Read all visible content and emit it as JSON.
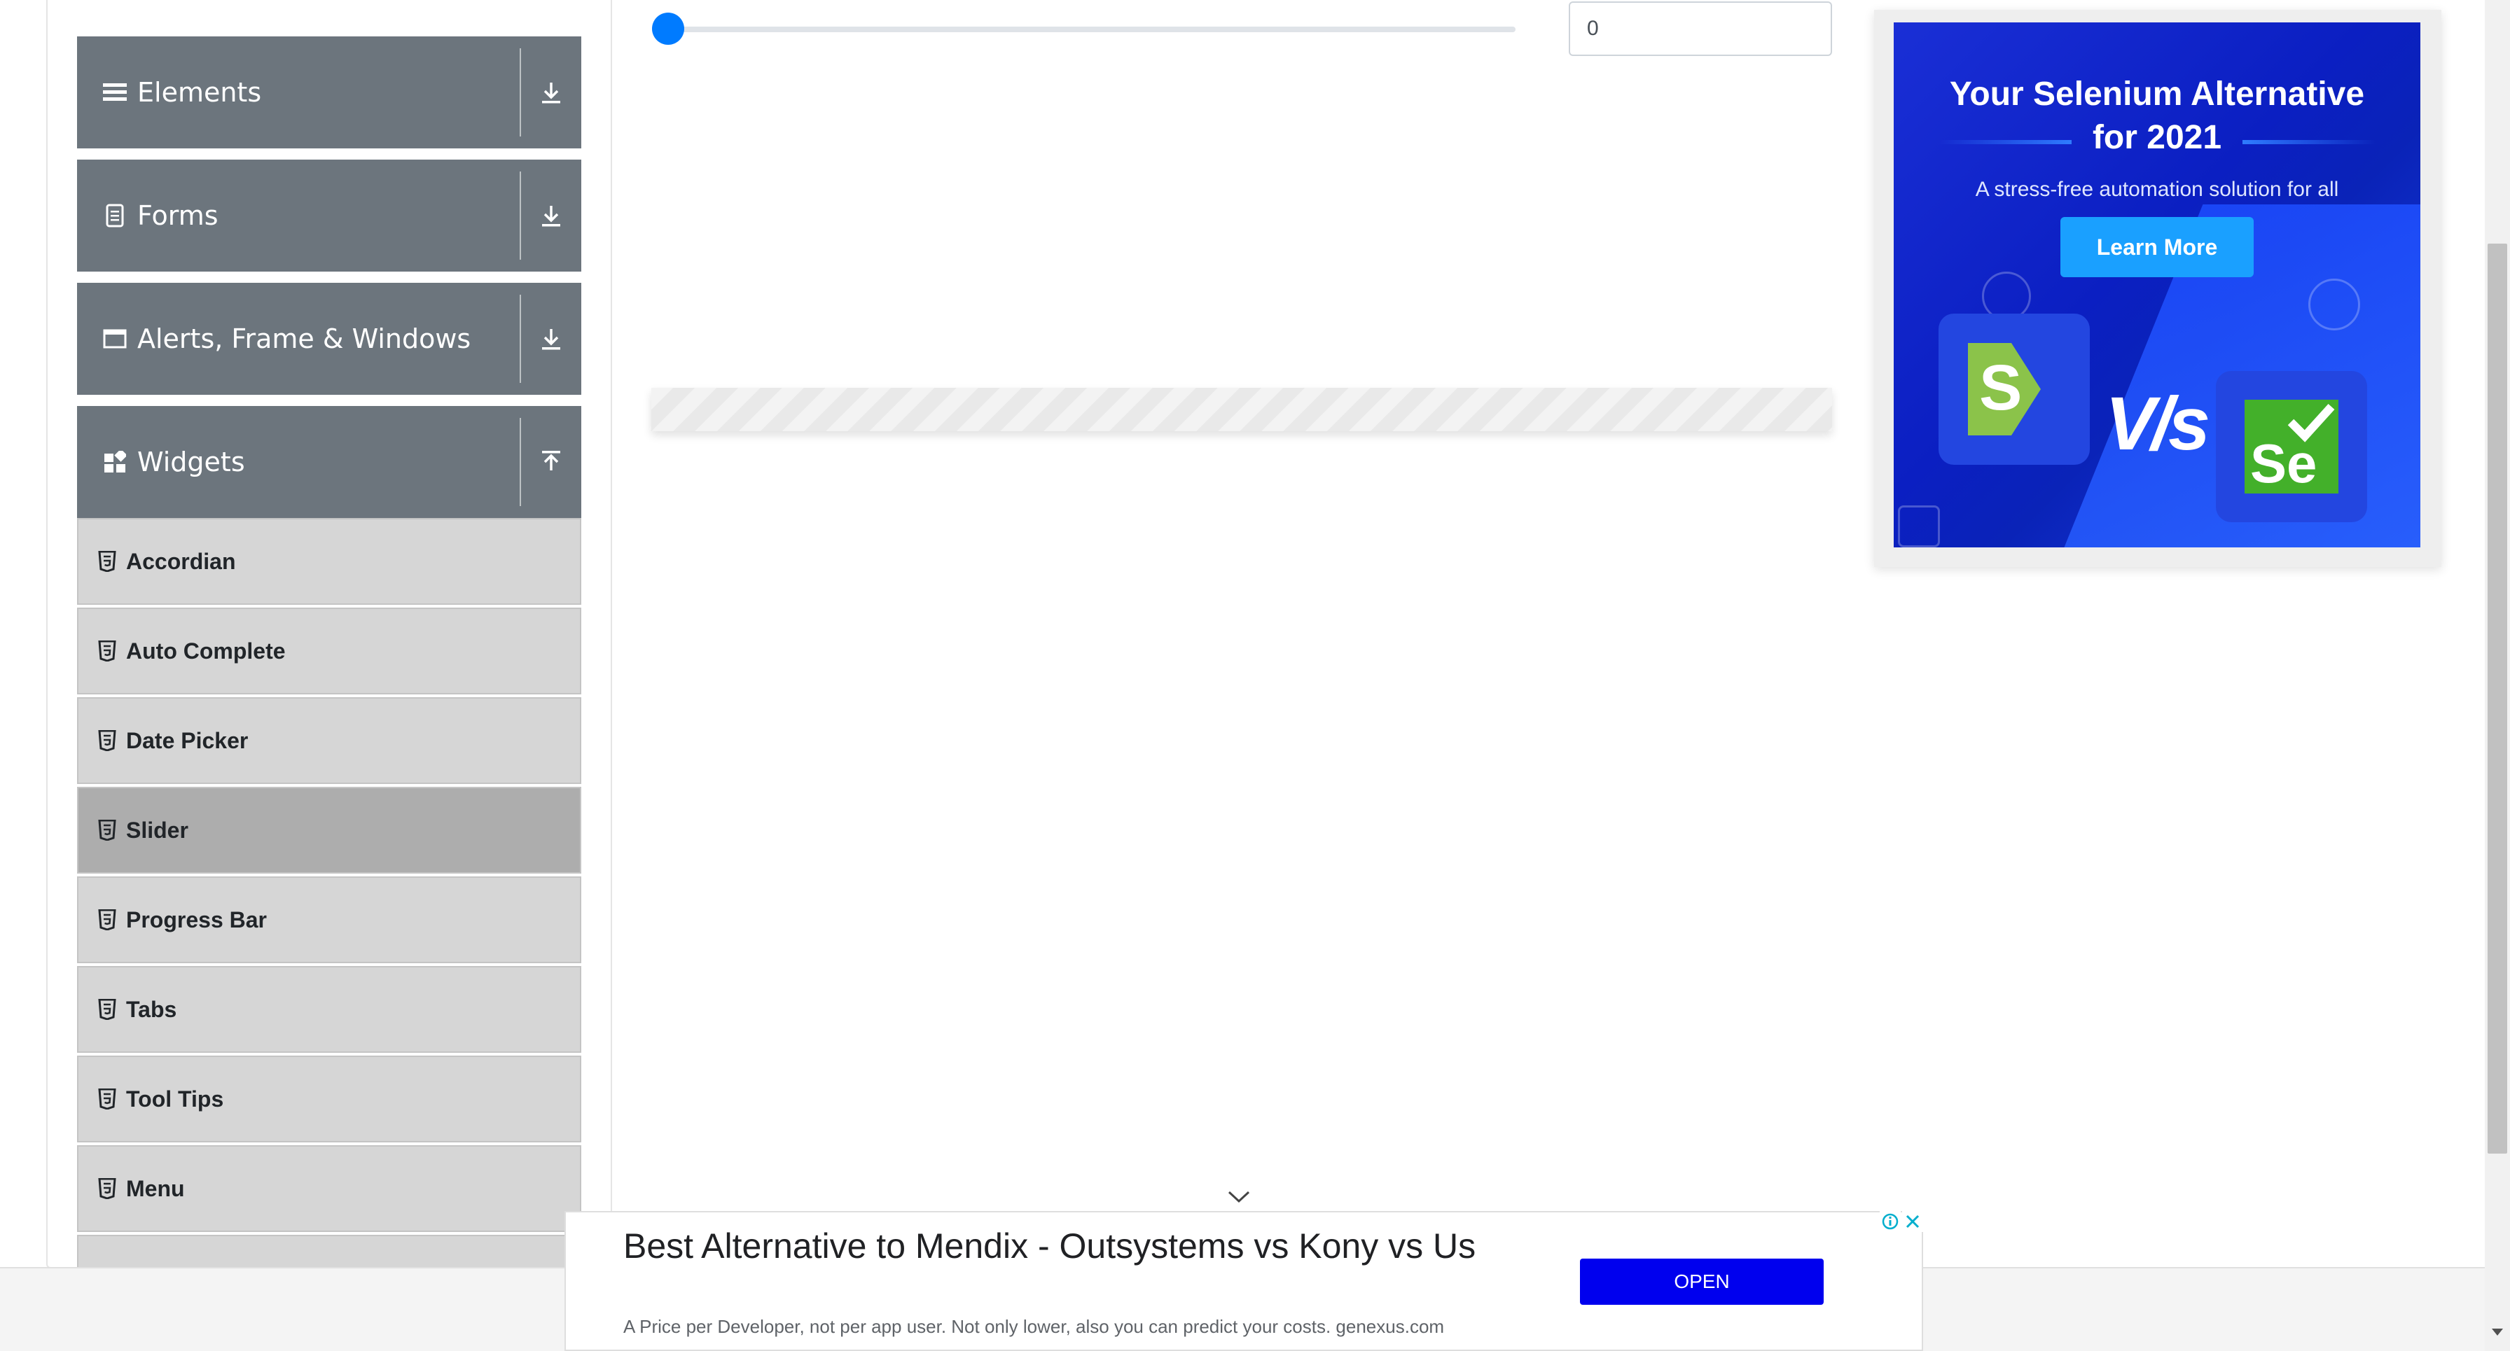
{
  "sidebar": {
    "groups": [
      {
        "label": "Elements",
        "icon": "hamburger-icon",
        "toggle": "download-icon"
      },
      {
        "label": "Forms",
        "icon": "document-icon",
        "toggle": "download-icon"
      },
      {
        "label": "Alerts, Frame & Windows",
        "icon": "window-icon",
        "toggle": "download-icon"
      },
      {
        "label": "Widgets",
        "icon": "widgets-icon",
        "toggle": "upload-icon"
      }
    ],
    "items": [
      {
        "label": "Accordian"
      },
      {
        "label": "Auto Complete"
      },
      {
        "label": "Date Picker"
      },
      {
        "label": "Slider",
        "active": true
      },
      {
        "label": "Progress Bar"
      },
      {
        "label": "Tabs"
      },
      {
        "label": "Tool Tips"
      },
      {
        "label": "Menu"
      }
    ]
  },
  "slider": {
    "value": "0",
    "min": 0,
    "max": 100,
    "accent": "#007bff"
  },
  "right_ad": {
    "title_line1": "Your Selenium Alternative",
    "title_line2": "for 2021",
    "subtitle": "A stress-free automation solution for all",
    "button": "Learn More",
    "left_logo": "S",
    "vs": "V/s",
    "right_logo": "Se"
  },
  "bottom_ad": {
    "title": "Best Alternative to Mendix - Outsystems vs Kony vs Us",
    "description": "A Price per Developer, not per app user. Not only lower, also you can predict your costs. genexus.com",
    "button": "OPEN",
    "button_color": "#0000ee"
  },
  "colors": {
    "sidebar_header": "#6c757d",
    "menu_item": "#d6d6d6",
    "menu_item_active": "#adadad"
  }
}
